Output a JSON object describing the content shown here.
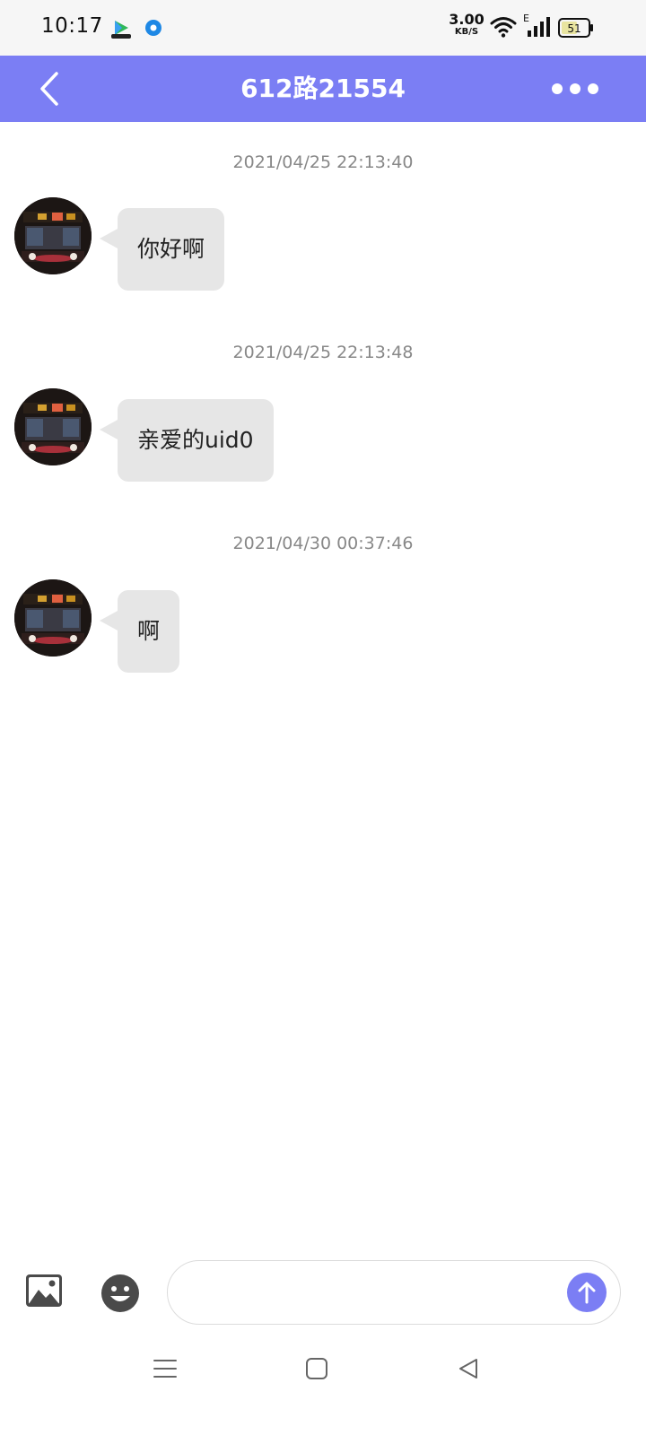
{
  "status_bar": {
    "time": "10:17",
    "net_speed_value": "3.00",
    "net_speed_unit": "KB/S",
    "network_type": "E",
    "battery": "51",
    "icons": [
      "video-app-icon",
      "blue-app-icon",
      "wifi-icon",
      "signal-icon",
      "battery-icon"
    ]
  },
  "header": {
    "title": "612路21554",
    "back_icon": "chevron-left-icon",
    "more_icon": "more-dots-icon",
    "background": "#7b7ef4"
  },
  "messages": [
    {
      "timestamp": "2021/04/25 22:13:40",
      "text": "你好啊"
    },
    {
      "timestamp": "2021/04/25 22:13:48",
      "text": "亲爱的uid0"
    },
    {
      "timestamp": "2021/04/30 00:37:46",
      "text": "啊"
    }
  ],
  "input_bar": {
    "image_icon": "image-icon",
    "emoji_icon": "emoji-icon",
    "input_value": "",
    "send_icon": "arrow-up-icon"
  },
  "nav_bar": {
    "icons": [
      "menu-icon",
      "home-square-icon",
      "back-triangle-icon"
    ]
  }
}
